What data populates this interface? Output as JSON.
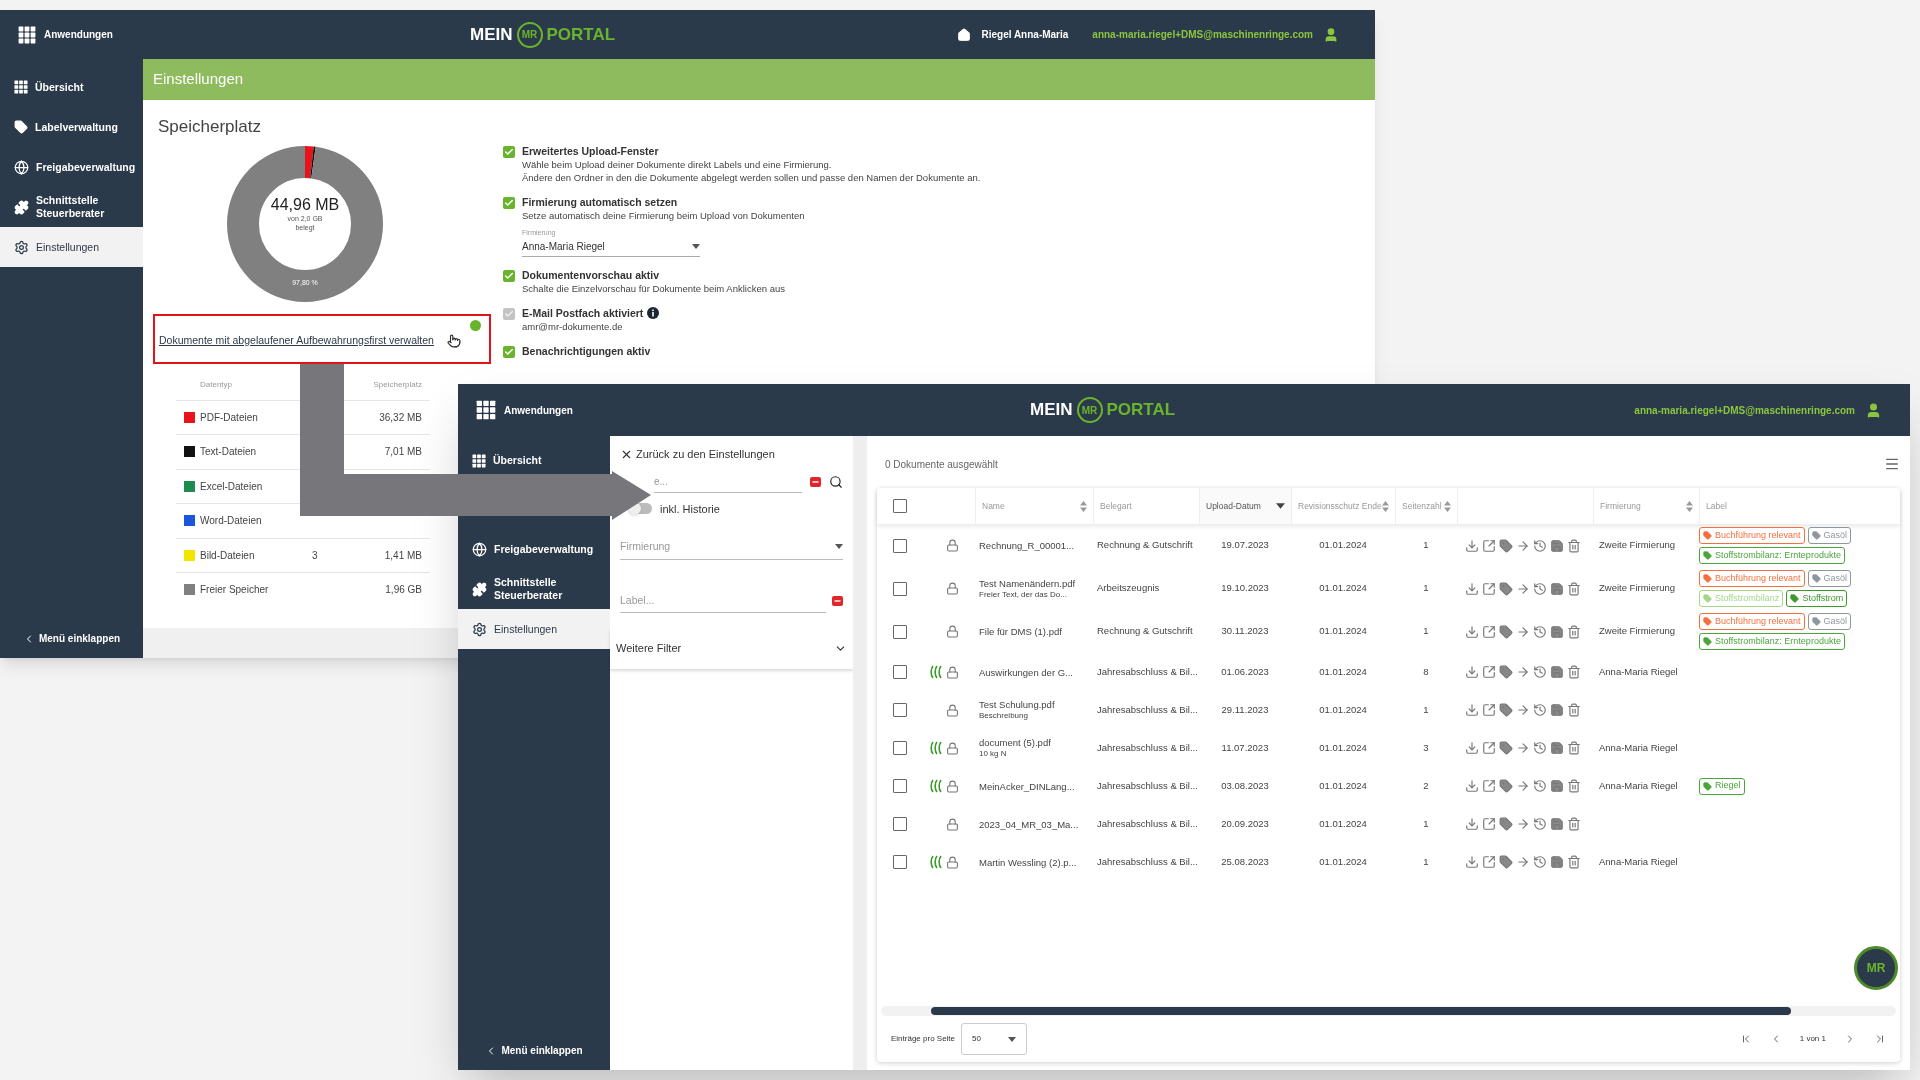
{
  "settings_window": {
    "header": {
      "apps_label": "Anwendungen",
      "logo": {
        "left": "MEIN",
        "badge": "MR",
        "right": "PORTAL"
      },
      "user_name": "Riegel Anna-Maria",
      "email": "anna-maria.riegel+DMS@maschinenringe.com"
    },
    "sidebar": {
      "items": [
        {
          "label": "Übersicht",
          "selected": false
        },
        {
          "label": "Labelverwaltung",
          "selected": false
        },
        {
          "label": "Freigabeverwaltung",
          "selected": false
        },
        {
          "label": "Schnittstelle Steuerberater",
          "selected": false
        },
        {
          "label": "Einstellungen",
          "selected": true
        }
      ],
      "collapse": "Menü einklappen"
    },
    "banner": "Einstellungen",
    "storage": {
      "title": "Speicherplatz",
      "used": "44,96 MB",
      "total": "von 2,0 GB",
      "caption": "belegt",
      "free_share": "97,80 %",
      "link": "Dokumente mit abgelaufener Aufbewahrungsfirst verwalten",
      "legend_columns": [
        "Datentyp",
        "Speicherplatz"
      ],
      "legend": [
        {
          "label": "PDF-Dateien",
          "color": "#e8141b",
          "size": "36,32 MB"
        },
        {
          "label": "Text-Dateien",
          "color": "#111111",
          "size": "7,01 MB"
        },
        {
          "label": "Excel-Dateien",
          "color": "#1d8a4e"
        },
        {
          "label": "Word-Dateien",
          "color": "#1a56db"
        },
        {
          "label": "Bild-Dateien",
          "color": "#f2e600",
          "count": "3",
          "size": "1,41 MB"
        },
        {
          "label": "Freier Speicher",
          "color": "#808080",
          "size": "1,96 GB"
        }
      ]
    },
    "settings": [
      {
        "title": "Erweitertes Upload-Fenster",
        "checked": true,
        "disabled": false,
        "description": [
          "Wähle beim Upload deiner Dokumente direkt Labels und eine Firmierung.",
          "Ändere den Ordner in den die Dokumente abgelegt werden sollen und passe den Namen der Dokumente an."
        ]
      },
      {
        "title": "Firmierung automatisch setzen",
        "checked": true,
        "disabled": false,
        "description": [
          "Setze automatisch deine Firmierung beim Upload von Dokumenten"
        ],
        "select": {
          "label": "Firmierung",
          "value": "Anna-Maria Riegel"
        }
      },
      {
        "title": "Dokumentenvorschau aktiv",
        "checked": true,
        "disabled": false,
        "description": [
          "Schalte die Einzelvorschau für Dokumente beim Anklicken aus"
        ]
      },
      {
        "title": "E-Mail Postfach aktiviert",
        "checked": true,
        "disabled": true,
        "info": true,
        "description": [
          "amr@mr-dokumente.de"
        ]
      },
      {
        "title": "Benachrichtigungen aktiv",
        "checked": true,
        "disabled": false
      }
    ]
  },
  "documents_window": {
    "header": {
      "apps_label": "Anwendungen",
      "logo": {
        "left": "MEIN",
        "badge": "MR",
        "right": "PORTAL"
      },
      "email": "anna-maria.riegel+DMS@maschinenringe.com"
    },
    "sidebar": {
      "items": [
        {
          "label": "Übersicht",
          "selected": false
        },
        {
          "label": "Freigabeverwaltung",
          "selected": false
        },
        {
          "label": "Schnittstelle Steuerberater",
          "selected": false
        },
        {
          "label": "Einstellungen",
          "selected": true
        }
      ],
      "collapse": "Menü einklappen"
    },
    "filters": {
      "back": "Zurück zu den Einstellungen",
      "search_placeholder": "e...",
      "history": {
        "label": "inkl. Historie",
        "on": false
      },
      "company_placeholder": "Firmierung",
      "label_placeholder": "Label...",
      "more": "Weitere Filter",
      "more_expanded": false
    },
    "selection": "0 Dokumente ausgewählt",
    "table": {
      "all_checked": false,
      "columns": [
        {
          "label": "Name",
          "sortable": true,
          "sorted": false
        },
        {
          "label": "Belegart",
          "sortable": false,
          "sorted": false
        },
        {
          "label": "Upload-Datum",
          "sortable": true,
          "sorted": true
        },
        {
          "label": "Revisionsschutz Ende",
          "sortable": true,
          "sorted": false
        },
        {
          "label": "Seitenzahl",
          "sortable": true,
          "sorted": false
        },
        {
          "label": "Firmierung",
          "sortable": true,
          "sorted": false
        },
        {
          "label": "Label",
          "sortable": false,
          "sorted": false
        }
      ],
      "rows": [
        {
          "checked": false,
          "synced": false,
          "name": "Rechnung_R_00001...",
          "type": "Rechnung & Gutschrift",
          "uploaded": "19.07.2023",
          "protected_until": "01.01.2024",
          "pages": "1",
          "company": "Zweite Firmierung",
          "labels": [
            {
              "text": "Buchführung relevant",
              "color": "#f4703f"
            },
            {
              "text": "Gasöl",
              "color": "#8e979e"
            },
            {
              "text": "Stoffstrombilanz: Ernteprodukte",
              "color": "#4aa63a"
            }
          ]
        },
        {
          "checked": false,
          "synced": false,
          "name": "Test Namenändern.pdf",
          "note": "Freier Text, der das Do...",
          "type": "Arbeitszeugnis",
          "uploaded": "19.10.2023",
          "protected_until": "01.01.2024",
          "pages": "1",
          "company": "Zweite Firmierung",
          "labels": [
            {
              "text": "Buchführung relevant",
              "color": "#f4703f"
            },
            {
              "text": "Gasöl",
              "color": "#8e979e"
            },
            {
              "text": "Stoffstrombilanz",
              "color": "#a5d68a"
            },
            {
              "text": "Stoffstrom",
              "color": "#3a9a2a"
            }
          ]
        },
        {
          "checked": false,
          "synced": false,
          "name": "File für DMS (1).pdf",
          "type": "Rechnung & Gutschrift",
          "uploaded": "30.11.2023",
          "protected_until": "01.01.2024",
          "pages": "1",
          "company": "Zweite Firmierung",
          "labels": [
            {
              "text": "Buchführung relevant",
              "color": "#f4703f"
            },
            {
              "text": "Gasöl",
              "color": "#8e979e"
            },
            {
              "text": "Stoffstrombilanz: Ernteprodukte",
              "color": "#4aa63a"
            }
          ]
        },
        {
          "checked": false,
          "synced": true,
          "name": "Auswirkungen der G...",
          "type": "Jahresabschluss & Bil...",
          "uploaded": "01.06.2023",
          "protected_until": "01.01.2024",
          "pages": "8",
          "company": "Anna-Maria Riegel"
        },
        {
          "checked": false,
          "synced": false,
          "name": "Test Schulung.pdf",
          "note": "Beschreibung",
          "type": "Jahresabschluss & Bil...",
          "uploaded": "29.11.2023",
          "protected_until": "01.01.2024",
          "pages": "1"
        },
        {
          "checked": false,
          "synced": true,
          "name": "document (5).pdf",
          "note": "10 kg N",
          "type": "Jahresabschluss & Bil...",
          "uploaded": "11.07.2023",
          "protected_until": "01.01.2024",
          "pages": "3",
          "company": "Anna-Maria Riegel"
        },
        {
          "checked": false,
          "synced": true,
          "name": "MeinAcker_DINLang...",
          "type": "Jahresabschluss & Bil...",
          "uploaded": "03.08.2023",
          "protected_until": "01.01.2024",
          "pages": "2",
          "company": "Anna-Maria Riegel",
          "labels": [
            {
              "text": "Riegel",
              "color": "#4aa63a"
            }
          ]
        },
        {
          "checked": false,
          "synced": false,
          "name": "2023_04_MR_03_Ma...",
          "type": "Jahresabschluss & Bil...",
          "uploaded": "20.09.2023",
          "protected_until": "01.01.2024",
          "pages": "1"
        },
        {
          "checked": false,
          "synced": true,
          "name": "Martin Wessling (2).p...",
          "type": "Jahresabschluss & Bil...",
          "uploaded": "25.08.2023",
          "protected_until": "01.01.2024",
          "pages": "1",
          "company": "Anna-Maria Riegel"
        }
      ]
    },
    "pagination": {
      "per_page_label": "Einträge pro Seite",
      "per_page": "50",
      "page": "1 von 1"
    },
    "fab": "MR"
  }
}
